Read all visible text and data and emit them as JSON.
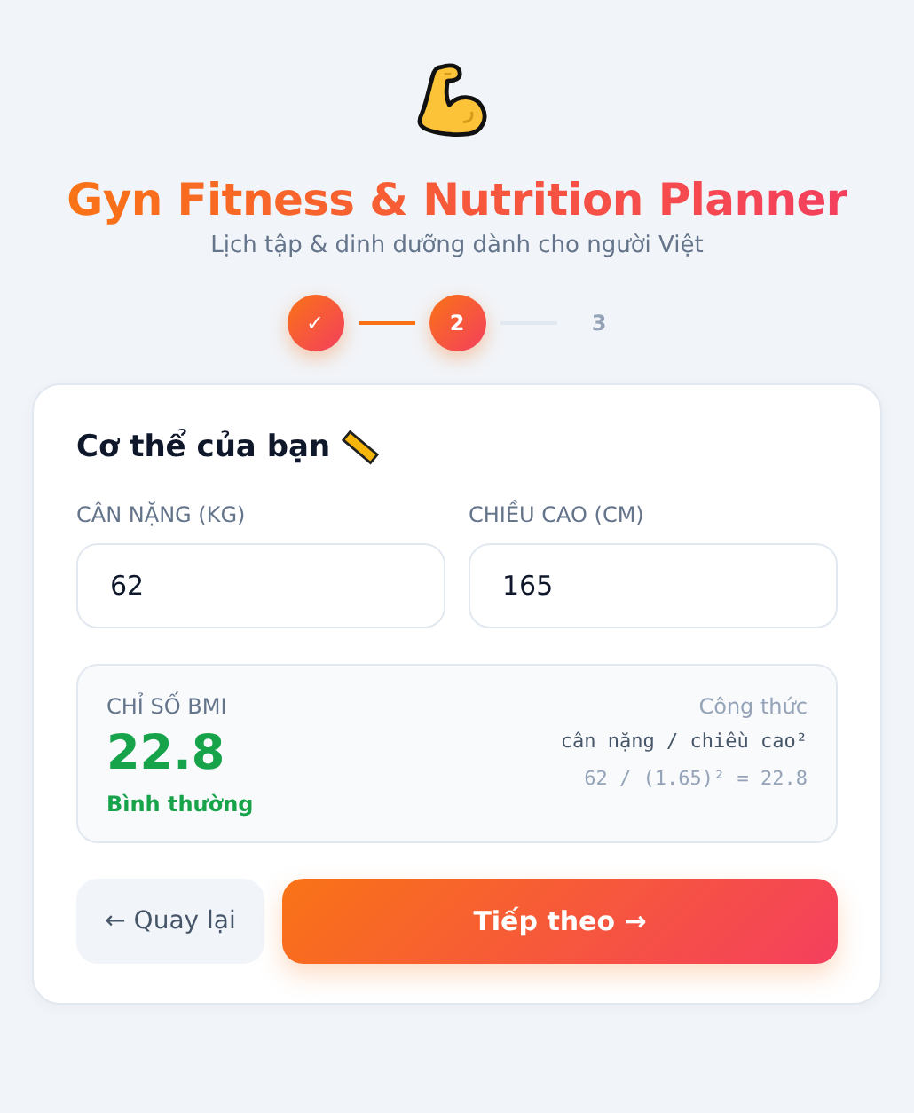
{
  "header": {
    "title": "Gyn Fitness & Nutrition Planner",
    "subtitle": "Lịch tập & dinh dưỡng dành cho người Việt"
  },
  "steps": [
    {
      "label": "✓",
      "kind": "done"
    },
    {
      "label": "2",
      "kind": "current"
    },
    {
      "label": "3",
      "kind": "upcoming"
    }
  ],
  "card": {
    "title": "Cơ thể của bạn",
    "fields": [
      {
        "label": "CÂN NẶNG (KG)",
        "value": "62"
      },
      {
        "label": "CHIỀU CAO (CM)",
        "value": "165"
      }
    ],
    "bmi": {
      "label": "CHỈ SỐ BMI",
      "value": "22.8",
      "category": "Bình thường",
      "formula_label": "Công thức",
      "formula": "cân nặng / chiều cao²",
      "calculation": "62 / (1.65)² = 22.8"
    },
    "buttons": {
      "back": "← Quay lại",
      "next": "Tiếp theo →"
    }
  }
}
